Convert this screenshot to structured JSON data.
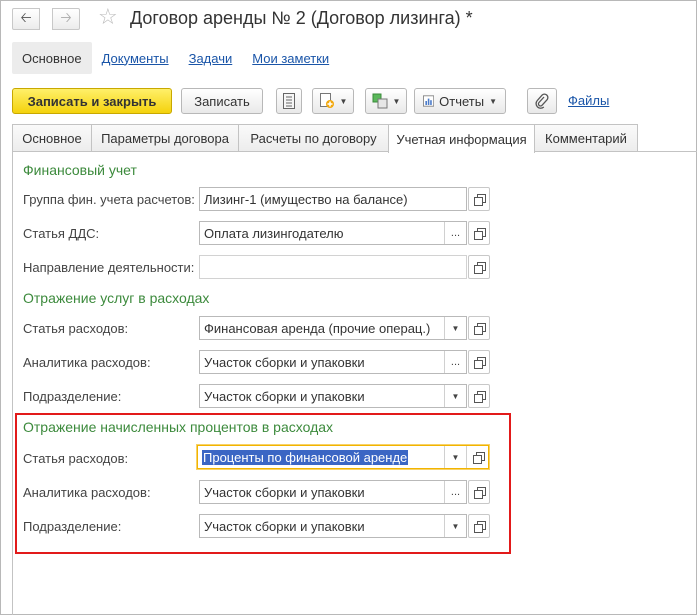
{
  "window": {
    "title": "Договор аренды № 2 (Договор лизинга) *"
  },
  "top_links": [
    "Основное",
    "Документы",
    "Задачи",
    "Мои заметки"
  ],
  "toolbar": {
    "save_close": "Записать и закрыть",
    "save": "Записать",
    "reports": "Отчеты",
    "files": "Файлы"
  },
  "tabs": [
    "Основное",
    "Параметры договора",
    "Расчеты по договору",
    "Учетная информация",
    "Комментарий"
  ],
  "active_tab": "Учетная информация",
  "sections": {
    "fin": {
      "title": "Финансовый учет",
      "group_label": "Группа фин. учета расчетов:",
      "group_value": "Лизинг-1 (имущество на балансе)",
      "dds_label": "Статья ДДС:",
      "dds_value": "Оплата лизингодателю",
      "direction_label": "Направление деятельности:",
      "direction_value": ""
    },
    "services": {
      "title": "Отражение услуг в расходах",
      "expense_label": "Статья расходов:",
      "expense_value": "Финансовая аренда (прочие операц.)",
      "analytics_label": "Аналитика расходов:",
      "analytics_value": "Участок сборки и упаковки",
      "dept_label": "Подразделение:",
      "dept_value": "Участок сборки и упаковки"
    },
    "interest": {
      "title": "Отражение начисленных процентов в расходах",
      "expense_label": "Статья расходов:",
      "expense_value": "Проценты по финансовой аренде",
      "analytics_label": "Аналитика расходов:",
      "analytics_value": "Участок сборки и упаковки",
      "dept_label": "Подразделение:",
      "dept_value": "Участок сборки и упаковки"
    }
  },
  "colors": {
    "section_title": "#3c8a3c",
    "primary_button": "#f4d20c",
    "highlight_box": "#e21a1a",
    "link": "#1a55a8"
  }
}
